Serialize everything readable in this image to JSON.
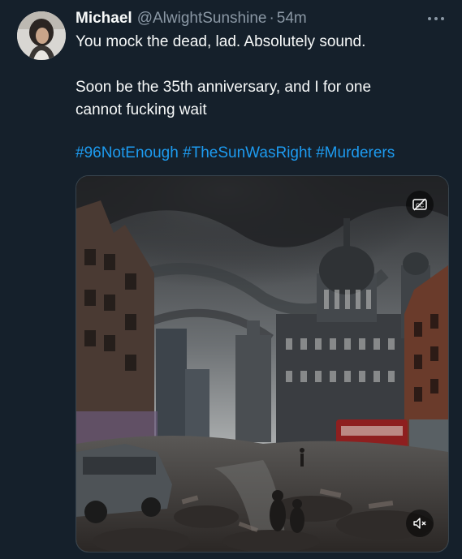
{
  "tweet": {
    "display_name": "Michael",
    "handle": "@AlwightSunshine",
    "separator": "·",
    "time": "54m",
    "text": {
      "line1": "You mock the dead, lad. Absolutely sound.",
      "line2": "Soon be the 35th anniversary, and I for one",
      "line3": "cannot fucking wait"
    },
    "hashtags": [
      "#96NotEnough",
      "#TheSunWasRight",
      "#Murderers"
    ]
  },
  "icons": {
    "more": "more-horizontal-icon",
    "captions": "captions-off-icon",
    "mute": "volume-muted-icon"
  },
  "colors": {
    "background": "#15202b",
    "primary_text": "#f7f9f9",
    "secondary_text": "#8b98a5",
    "link": "#1d9bf0",
    "border": "#38444d"
  }
}
